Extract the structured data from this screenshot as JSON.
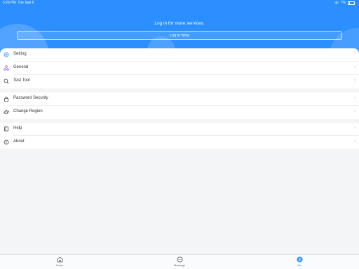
{
  "status_bar": {
    "time": "5:26 PM",
    "date": "Tue Sep 6",
    "battery": "7%"
  },
  "header": {
    "login_prompt": "Log in for more services.",
    "login_button": "Log in Now"
  },
  "menu": {
    "items": [
      {
        "label": "Setting",
        "icon": "gear-icon"
      },
      {
        "label": "General",
        "icon": "nodes-icon"
      },
      {
        "label": "Test Tool",
        "icon": "magnifier-icon"
      },
      {
        "label": "Password Security",
        "icon": "lock-icon"
      },
      {
        "label": "Change Region",
        "icon": "planet-icon"
      },
      {
        "label": "Help",
        "icon": "book-icon"
      },
      {
        "label": "About",
        "icon": "info-icon"
      }
    ]
  },
  "tabbar": {
    "tabs": [
      {
        "label": "Home",
        "icon": "home-icon"
      },
      {
        "label": "Message",
        "icon": "chat-icon"
      },
      {
        "label": "Me",
        "icon": "user-icon"
      }
    ],
    "active_tab": "Me"
  },
  "colors": {
    "accent": "#2b8fff",
    "background": "#f4f5f7"
  }
}
